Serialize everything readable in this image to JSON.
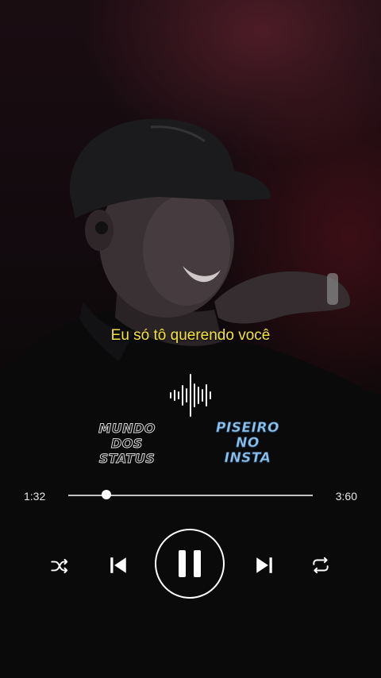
{
  "player": {
    "lyric": "Eu só tô querendo você",
    "time_current": "1:32",
    "time_total": "3:60",
    "progress": 0.155,
    "state": "playing"
  },
  "logos": {
    "mundo_dos_status": [
      "MUNDO",
      "DOS",
      "STATUS"
    ],
    "piseiro_no_insta": [
      "PISEIRO",
      "NO",
      "INSTA"
    ]
  },
  "icons": {
    "wave": "sound-wave-icon",
    "shuffle": "shuffle-icon",
    "previous": "skip-previous-icon",
    "play_pause": "pause-icon",
    "next": "skip-next-icon",
    "repeat": "repeat-icon"
  },
  "colors": {
    "lyric": "#f3e23c",
    "logo_piseiro": "#8fc2ea",
    "controls": "#ffffff"
  }
}
